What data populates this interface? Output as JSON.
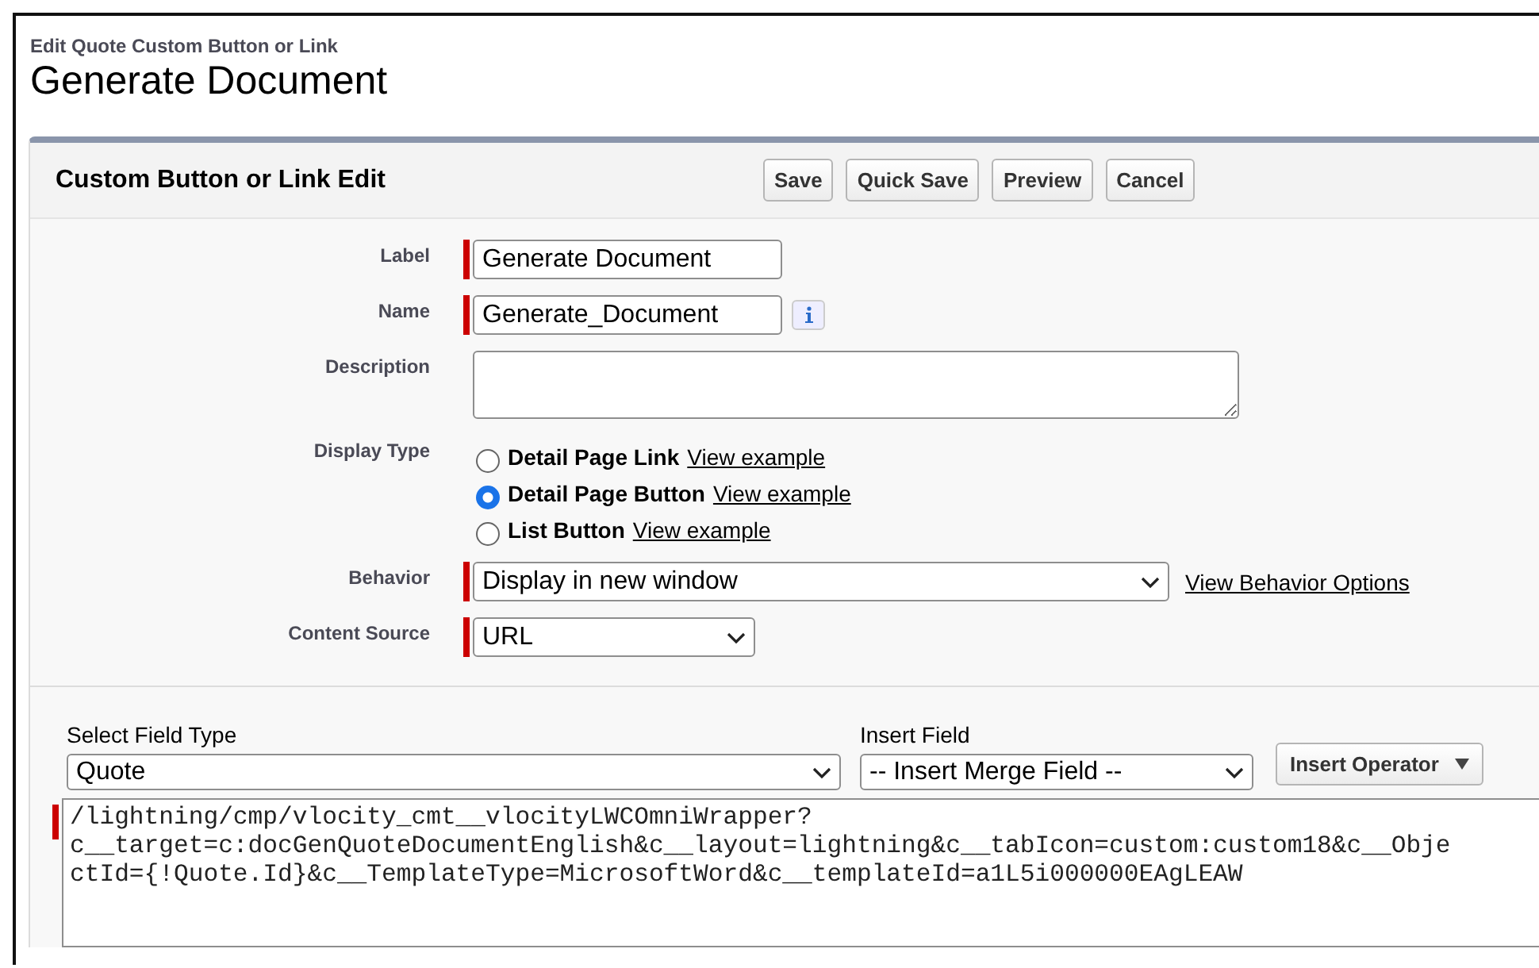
{
  "breadcrumb": "Edit Quote Custom Button or Link",
  "title": "Generate Document",
  "panel": {
    "title": "Custom Button or Link Edit",
    "buttons": [
      "Save",
      "Quick Save",
      "Preview",
      "Cancel"
    ]
  },
  "fields": [
    {
      "kind": "text",
      "label": "Label",
      "value": "Generate Document",
      "required": true,
      "info": false
    },
    {
      "kind": "text",
      "label": "Name",
      "value": "Generate_Document",
      "required": true,
      "info": true
    },
    {
      "kind": "textarea",
      "label": "Description",
      "required": false
    },
    {
      "kind": "radios",
      "label": "Display Type",
      "options": [
        {
          "label": "Detail Page Link",
          "link": "View example",
          "selected": false
        },
        {
          "label": "Detail Page Button",
          "link": "View example",
          "selected": true
        },
        {
          "label": "List Button",
          "link": "View example",
          "selected": false
        }
      ]
    },
    {
      "kind": "select",
      "label": "Behavior",
      "value": "Display in new window",
      "required": true,
      "link": "View Behavior Options"
    },
    {
      "kind": "select",
      "label": "Content Source",
      "value": "URL",
      "required": true
    }
  ],
  "formula": {
    "field_type": {
      "label": "Select Field Type",
      "value": "Quote"
    },
    "insert_field": {
      "label": "Insert Field",
      "value": "-- Insert Merge Field --"
    },
    "operator_button": "Insert Operator",
    "required": true,
    "lines": [
      "/lightning/cmp/vlocity_cmt__vlocityLWCOmniWrapper?",
      "c__target=c:docGenQuoteDocumentEnglish&c__layout=lightning&c__tabIcon=custom:custom18&c__Obje",
      "ctId={!Quote.Id}&c__TemplateType=MicrosoftWord&c__templateId=a1L5i000000EAgLEAW"
    ]
  }
}
